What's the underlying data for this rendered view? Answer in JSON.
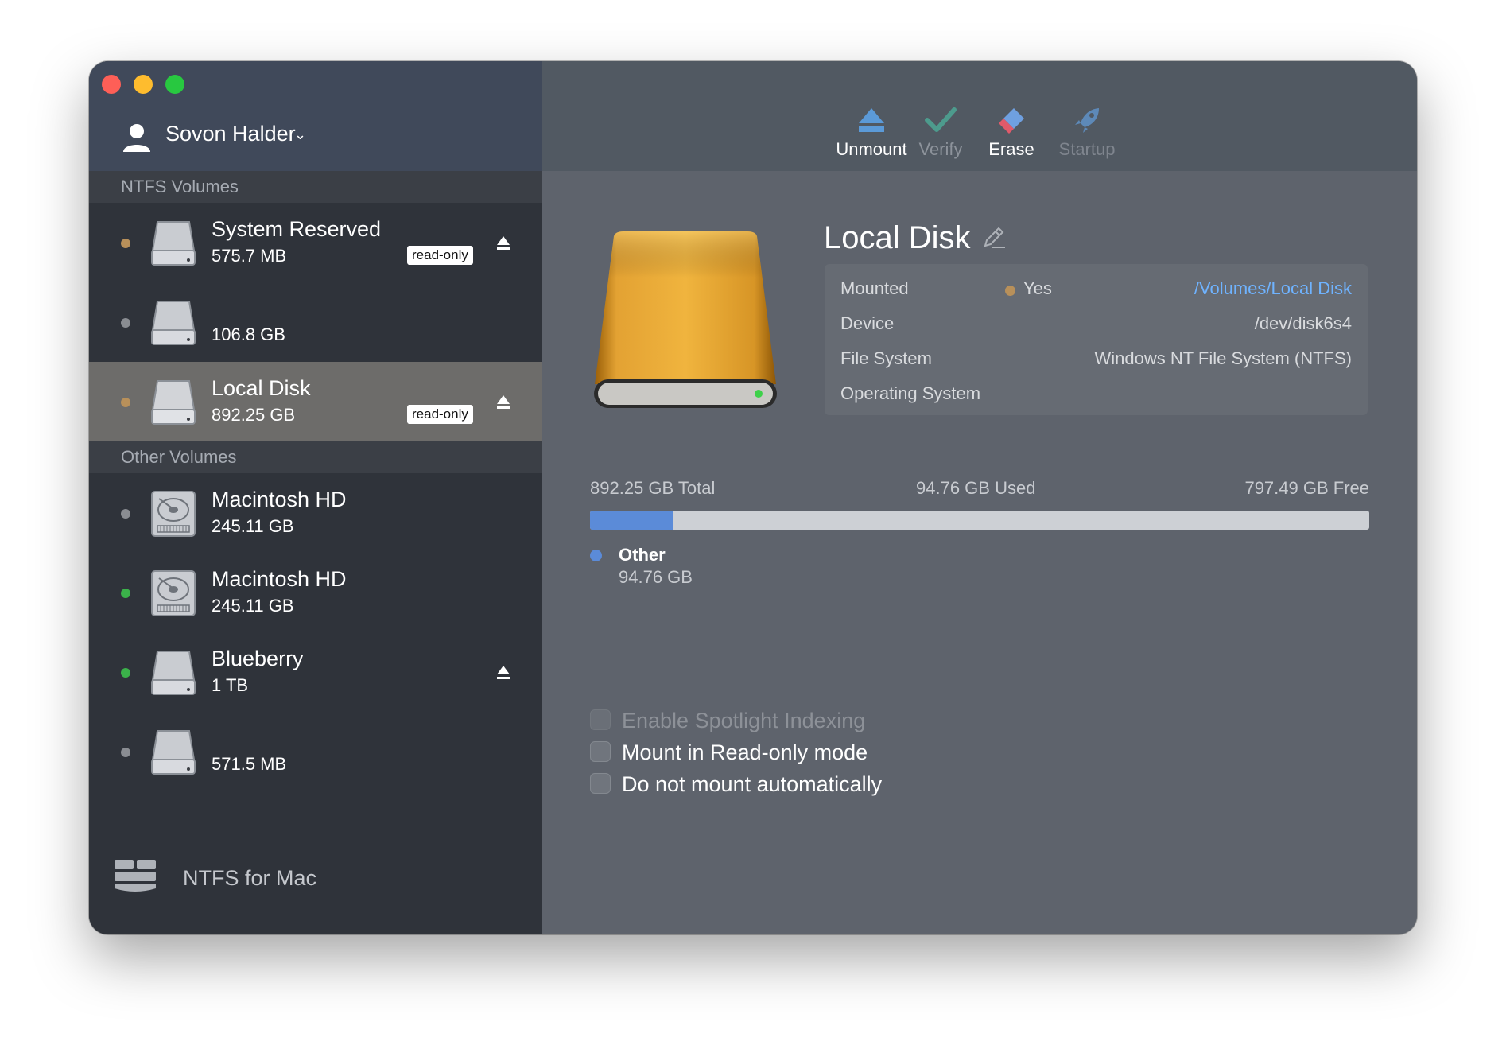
{
  "colors": {
    "dot_orange": "#b8905a",
    "dot_gray": "#8a8d92",
    "dot_green": "#3bb24a",
    "used_bar": "#5b8bd8",
    "link": "#6fb3ff"
  },
  "user": {
    "name": "Sovon Halder",
    "caret": "⌄",
    "icon": "user-icon"
  },
  "sidebar": {
    "ntfs_title": "NTFS Volumes",
    "other_title": "Other Volumes",
    "ntfs_volumes": [
      {
        "name": "System Reserved",
        "size": "575.7 MB",
        "badge": "read-only",
        "eject": true,
        "dot": "orange",
        "icon": "drive-icon"
      },
      {
        "name": "",
        "size": "106.8 GB",
        "badge": "",
        "eject": false,
        "dot": "gray",
        "icon": "drive-icon"
      },
      {
        "name": "Local Disk",
        "size": "892.25 GB",
        "badge": "read-only",
        "eject": true,
        "dot": "orange",
        "icon": "drive-icon",
        "selected": true
      }
    ],
    "other_volumes": [
      {
        "name": "Macintosh HD",
        "size": "245.11 GB",
        "dot": "gray",
        "icon": "hard-disk-icon"
      },
      {
        "name": "Macintosh HD",
        "size": "245.11 GB",
        "dot": "green",
        "icon": "hard-disk-icon"
      },
      {
        "name": "Blueberry",
        "size": "1 TB",
        "dot": "green",
        "eject": true,
        "icon": "drive-icon"
      },
      {
        "name": "",
        "size": "571.5 MB",
        "dot": "gray",
        "icon": "drive-icon"
      }
    ],
    "footer_label": "NTFS for Mac"
  },
  "toolbar": {
    "unmount": "Unmount",
    "verify": "Verify",
    "erase": "Erase",
    "startup": "Startup"
  },
  "disk": {
    "title": "Local Disk",
    "mounted_label": "Mounted",
    "mounted_value": "Yes",
    "mount_path": "/Volumes/Local Disk",
    "device_label": "Device",
    "device_value": "/dev/disk6s4",
    "fs_label": "File System",
    "fs_value": "Windows NT File System (NTFS)",
    "os_label": "Operating System",
    "os_value": ""
  },
  "usage": {
    "total": "892.25 GB Total",
    "used": "94.76 GB Used",
    "free": "797.49 GB Free",
    "used_fraction": 0.1062,
    "legend_name": "Other",
    "legend_size": "94.76 GB"
  },
  "options": {
    "spotlight": "Enable Spotlight Indexing",
    "readonly": "Mount in Read-only mode",
    "noauto": "Do not mount automatically"
  }
}
